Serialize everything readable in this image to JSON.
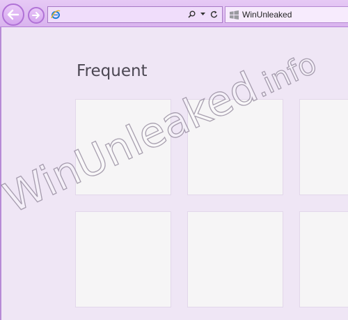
{
  "browser": {
    "address_value": "",
    "tab_title": "WinUnleaked"
  },
  "page": {
    "heading": "Frequent"
  },
  "watermark": {
    "main": "WinUnleaked",
    "suffix": ".info"
  },
  "colors": {
    "chrome": "#dcb8f0",
    "page_background": "#efe6f5",
    "tile": "#f6f5f6",
    "accent": "#b072d6"
  },
  "icons": [
    "back-arrow-icon",
    "forward-arrow-icon",
    "ie-logo-icon",
    "search-icon",
    "dropdown-icon",
    "refresh-icon",
    "windows-logo-icon"
  ]
}
